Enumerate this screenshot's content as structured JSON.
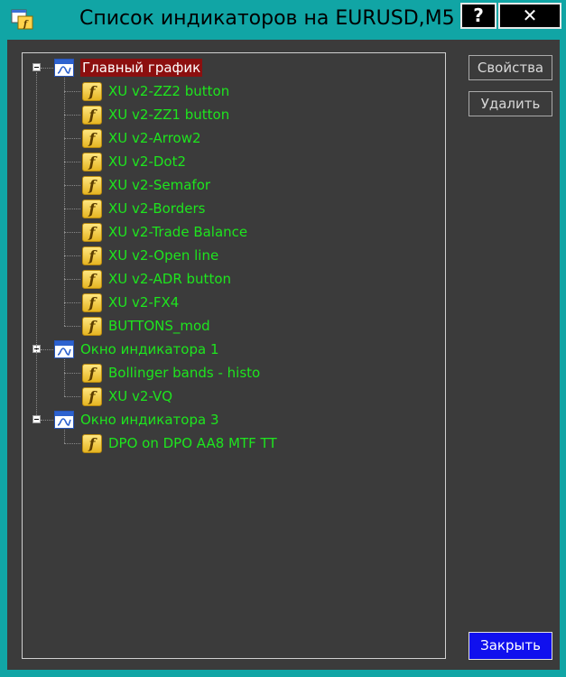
{
  "window": {
    "title": "Список индикаторов на EURUSD,M5",
    "help_label": "?",
    "close_label": "✕"
  },
  "tree": {
    "groups": [
      {
        "label": "Главный график",
        "selected": true,
        "items": [
          "XU v2-ZZ2 button",
          "XU v2-ZZ1 button",
          "XU v2-Arrow2",
          "XU v2-Dot2",
          "XU v2-Semafor",
          "XU v2-Borders",
          "XU v2-Trade Balance",
          "XU v2-Open line",
          "XU v2-ADR button",
          "XU v2-FX4",
          "BUTTONS_mod"
        ]
      },
      {
        "label": "Окно индикатора 1",
        "selected": false,
        "items": [
          "Bollinger bands - histo",
          "XU v2-VQ"
        ]
      },
      {
        "label": "Окно индикатора 3",
        "selected": false,
        "items": [
          "DPO on DPO AA8 MTF TT"
        ]
      }
    ]
  },
  "buttons": {
    "properties": "Свойства",
    "delete": "Удалить",
    "close": "Закрыть"
  },
  "colors": {
    "frame": "#11a5a5",
    "background": "#3b3b3b",
    "item_text": "#1ee51e",
    "selection": "#8c0f0f",
    "close_button": "#1010ee"
  },
  "icons": {
    "group_icon": "chart-window-icon",
    "item_icon": "custom-indicator-icon"
  }
}
